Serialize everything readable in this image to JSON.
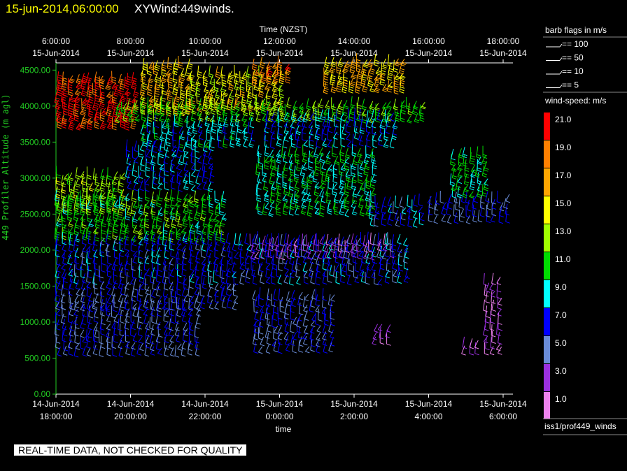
{
  "header": {
    "timestamp": "15-jun-2014,06:00:00",
    "title": "XYWind:449winds."
  },
  "chart_data": {
    "type": "scatter",
    "title": "",
    "top_axis": {
      "label": "Time (NZST)",
      "ticks": [
        {
          "time": "6:00:00",
          "date": "15-Jun-2014"
        },
        {
          "time": "8:00:00",
          "date": "15-Jun-2014"
        },
        {
          "time": "10:00:00",
          "date": "15-Jun-2014"
        },
        {
          "time": "12:00:00",
          "date": "15-Jun-2014"
        },
        {
          "time": "14:00:00",
          "date": "15-Jun-2014"
        },
        {
          "time": "16:00:00",
          "date": "15-Jun-2014"
        },
        {
          "time": "18:00:00",
          "date": "15-Jun-2014"
        }
      ]
    },
    "bottom_axis": {
      "label": "time",
      "ticks": [
        {
          "date": "14-Jun-2014",
          "time": "18:00:00"
        },
        {
          "date": "14-Jun-2014",
          "time": "20:00:00"
        },
        {
          "date": "14-Jun-2014",
          "time": "22:00:00"
        },
        {
          "date": "15-Jun-2014",
          "time": "0:00:00"
        },
        {
          "date": "15-Jun-2014",
          "time": "2:00:00"
        },
        {
          "date": "15-Jun-2014",
          "time": "4:00:00"
        },
        {
          "date": "15-Jun-2014",
          "time": "6:00:00"
        }
      ]
    },
    "y_axis": {
      "label": "449 Profiler Altitude (m agl)",
      "ticks": [
        "0.00",
        "500.00",
        "1000.00",
        "1500.00",
        "2000.00",
        "2500.00",
        "3000.00",
        "3500.00",
        "4000.00",
        "4500.00"
      ],
      "range": [
        0,
        4600
      ]
    },
    "x_range_hours": [
      0,
      12
    ],
    "series_note": "wind barbs colored by wind speed (m/s)",
    "bands": [
      {
        "t0": 0.0,
        "t1": 2.1,
        "z0": 3700,
        "z1": 4350,
        "speed": 20
      },
      {
        "t0": 2.3,
        "t1": 3.6,
        "z0": 3900,
        "z1": 4550,
        "speed": 16
      },
      {
        "t0": 3.6,
        "t1": 6.0,
        "z0": 3950,
        "z1": 4400,
        "speed": 15
      },
      {
        "t0": 5.3,
        "t1": 6.2,
        "z0": 4350,
        "z1": 4580,
        "speed": 19
      },
      {
        "t0": 7.2,
        "t1": 9.4,
        "z0": 4200,
        "z1": 4580,
        "speed": 16
      },
      {
        "t0": 1.6,
        "t1": 9.8,
        "z0": 3800,
        "z1": 4050,
        "speed": 12
      },
      {
        "t0": 2.3,
        "t1": 5.2,
        "z0": 3450,
        "z1": 3800,
        "speed": 9
      },
      {
        "t0": 5.6,
        "t1": 9.0,
        "z0": 3450,
        "z1": 3850,
        "speed": 8
      },
      {
        "t0": 0.0,
        "t1": 1.8,
        "z0": 2550,
        "z1": 3050,
        "speed": 13
      },
      {
        "t0": 0.0,
        "t1": 4.5,
        "z0": 2150,
        "z1": 2750,
        "speed": 11
      },
      {
        "t0": 1.9,
        "t1": 4.2,
        "z0": 2850,
        "z1": 3400,
        "speed": 8
      },
      {
        "t0": 5.4,
        "t1": 8.6,
        "z0": 2500,
        "z1": 3350,
        "speed": 10
      },
      {
        "t0": 8.4,
        "t1": 9.8,
        "z0": 2350,
        "z1": 2650,
        "speed": 7
      },
      {
        "t0": 10.0,
        "t1": 12.2,
        "z0": 2400,
        "z1": 2700,
        "speed": 6
      },
      {
        "t0": 10.6,
        "t1": 11.6,
        "z0": 2750,
        "z1": 3300,
        "speed": 10
      },
      {
        "t0": 0.0,
        "t1": 9.4,
        "z0": 1550,
        "z1": 2150,
        "speed": 7
      },
      {
        "t0": 5.2,
        "t1": 9.0,
        "z0": 1900,
        "z1": 2150,
        "speed": 3
      },
      {
        "t0": 0.0,
        "t1": 4.8,
        "z0": 1200,
        "z1": 1550,
        "speed": 6
      },
      {
        "t0": 0.0,
        "t1": 3.8,
        "z0": 550,
        "z1": 1200,
        "speed": 6
      },
      {
        "t0": 5.3,
        "t1": 7.4,
        "z0": 600,
        "z1": 1400,
        "speed": 6
      },
      {
        "t0": 8.5,
        "t1": 9.0,
        "z0": 700,
        "z1": 900,
        "speed": 3
      },
      {
        "t0": 10.9,
        "t1": 11.4,
        "z0": 550,
        "z1": 700,
        "speed": 2
      },
      {
        "t0": 11.5,
        "t1": 12.0,
        "z0": 550,
        "z1": 1600,
        "speed": 2
      }
    ]
  },
  "legend": {
    "barb_title": "barb flags in m/s",
    "barb_items": [
      "== 100",
      "== 50",
      "== 10",
      "== 5"
    ],
    "speed_title": "wind-speed: m/s",
    "colorbar": [
      {
        "label": "21.0",
        "color": "#ff0000"
      },
      {
        "label": "19.0",
        "color": "#ff7f00"
      },
      {
        "label": "17.0",
        "color": "#ffa500"
      },
      {
        "label": "15.0",
        "color": "#ffff00"
      },
      {
        "label": "13.0",
        "color": "#a0ff00"
      },
      {
        "label": "11.0",
        "color": "#00dd00"
      },
      {
        "label": "9.0",
        "color": "#00ffff"
      },
      {
        "label": "7.0",
        "color": "#0000ff"
      },
      {
        "label": "5.0",
        "color": "#6a8cd8"
      },
      {
        "label": "3.0",
        "color": "#9b30e0"
      },
      {
        "label": "1.0",
        "color": "#ee82ee"
      }
    ],
    "source": "iss1/prof449_winds"
  },
  "footer": {
    "warning": "REAL-TIME DATA, NOT CHECKED FOR QUALITY"
  }
}
